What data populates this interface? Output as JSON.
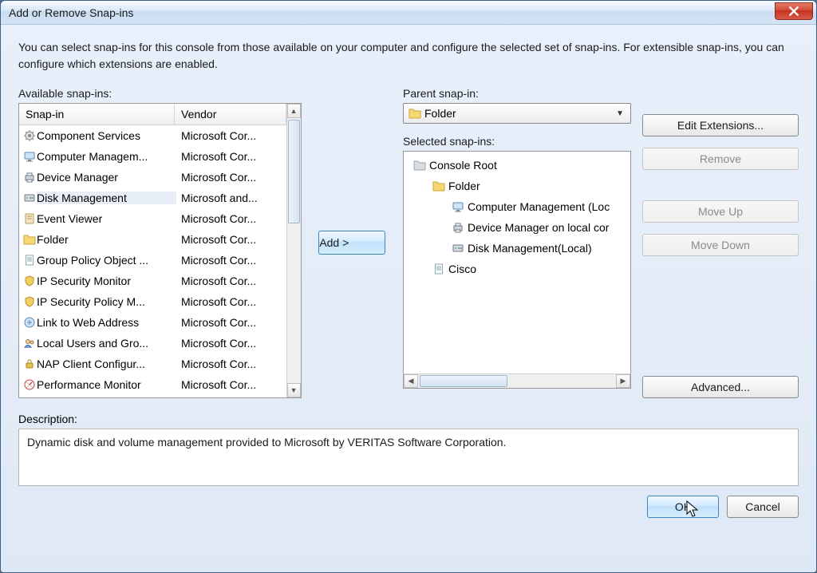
{
  "title": "Add or Remove Snap-ins",
  "intro": "You can select snap-ins for this console from those available on your computer and configure the selected set of snap-ins. For extensible snap-ins, you can configure which extensions are enabled.",
  "labels": {
    "available": "Available snap-ins:",
    "parent": "Parent snap-in:",
    "selected": "Selected snap-ins:",
    "description": "Description:",
    "col_snapin": "Snap-in",
    "col_vendor": "Vendor"
  },
  "buttons": {
    "add": "Add >",
    "edit_ext": "Edit Extensions...",
    "remove": "Remove",
    "move_up": "Move Up",
    "move_down": "Move Down",
    "advanced": "Advanced...",
    "ok": "OK",
    "cancel": "Cancel"
  },
  "parent_combo": "Folder",
  "available_items": [
    {
      "name": "Component Services",
      "vendor": "Microsoft Cor...",
      "icon": "gear"
    },
    {
      "name": "Computer Managem...",
      "vendor": "Microsoft Cor...",
      "icon": "monitor"
    },
    {
      "name": "Device Manager",
      "vendor": "Microsoft Cor...",
      "icon": "printer"
    },
    {
      "name": "Disk Management",
      "vendor": "Microsoft and...",
      "icon": "disk",
      "selected": true
    },
    {
      "name": "Event Viewer",
      "vendor": "Microsoft Cor...",
      "icon": "book"
    },
    {
      "name": "Folder",
      "vendor": "Microsoft Cor...",
      "icon": "folder"
    },
    {
      "name": "Group Policy Object ...",
      "vendor": "Microsoft Cor...",
      "icon": "doc"
    },
    {
      "name": "IP Security Monitor",
      "vendor": "Microsoft Cor...",
      "icon": "shield"
    },
    {
      "name": "IP Security Policy M...",
      "vendor": "Microsoft Cor...",
      "icon": "shield"
    },
    {
      "name": "Link to Web Address",
      "vendor": "Microsoft Cor...",
      "icon": "link"
    },
    {
      "name": "Local Users and Gro...",
      "vendor": "Microsoft Cor...",
      "icon": "users"
    },
    {
      "name": "NAP Client Configur...",
      "vendor": "Microsoft Cor...",
      "icon": "lock"
    },
    {
      "name": "Performance Monitor",
      "vendor": "Microsoft Cor...",
      "icon": "perf"
    }
  ],
  "tree": [
    {
      "depth": 0,
      "label": "Console Root",
      "icon": "folder-gray"
    },
    {
      "depth": 1,
      "label": "Folder",
      "icon": "folder"
    },
    {
      "depth": 2,
      "label": "Computer Management (Loc",
      "icon": "monitor"
    },
    {
      "depth": 2,
      "label": "Device Manager on local cor",
      "icon": "printer"
    },
    {
      "depth": 2,
      "label": "Disk Management(Local)",
      "icon": "disk"
    },
    {
      "depth": 1,
      "label": "Cisco",
      "icon": "doc"
    }
  ],
  "description_text": "Dynamic disk and volume management provided to Microsoft by VERITAS Software Corporation."
}
